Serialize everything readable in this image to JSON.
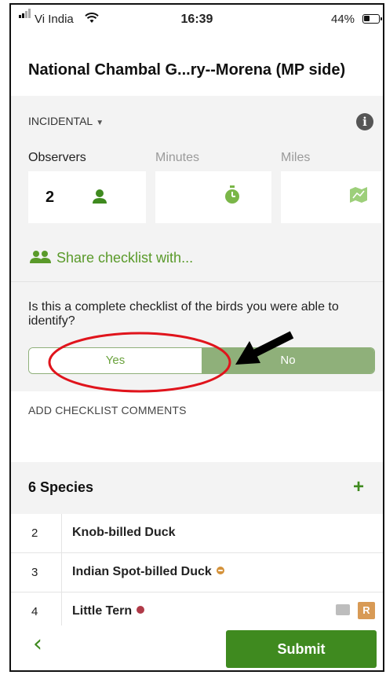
{
  "status_bar": {
    "carrier": "Vi India",
    "time": "16:39",
    "battery": "44%",
    "battery_level": 0.44,
    "signal_icon": "signal-bars-icon",
    "wifi_icon": "wifi-icon"
  },
  "header": {
    "title": "National Chambal G...ry--Morena (MP side)"
  },
  "protocol": {
    "label": "INCIDENTAL",
    "caret": "▼",
    "info_icon": "info-icon"
  },
  "fields": {
    "observers": {
      "label": "Observers",
      "value": "2",
      "icon": "person-icon"
    },
    "minutes": {
      "label": "Minutes",
      "icon": "stopwatch-icon"
    },
    "miles": {
      "label": "Miles",
      "icon": "map-icon"
    }
  },
  "share": {
    "label": "Share checklist with...",
    "icon": "group-icon"
  },
  "complete": {
    "question": "Is this a complete checklist of the birds you were able to identify?",
    "yes_label": "Yes",
    "no_label": "No",
    "selected": "No"
  },
  "comments": {
    "label": "ADD CHECKLIST COMMENTS"
  },
  "species": {
    "title": "6 Species",
    "add_label": "+",
    "rows": [
      {
        "count": "2",
        "name": "Knob-billed Duck"
      },
      {
        "count": "3",
        "name": "Indian Spot-billed Duck"
      },
      {
        "count": "4",
        "name": "Little Tern"
      }
    ],
    "r_badge": "R"
  },
  "footer": {
    "back_label": "‹",
    "submit_label": "Submit"
  },
  "colors": {
    "accent_green": "#3f8a1f",
    "toggle_green": "#8fb07a",
    "annotation_red": "#e0141c",
    "badge_orange": "#d89a55",
    "rare_dot_red": "#b03a48",
    "uncommon_dot_orange": "#d4923a"
  }
}
